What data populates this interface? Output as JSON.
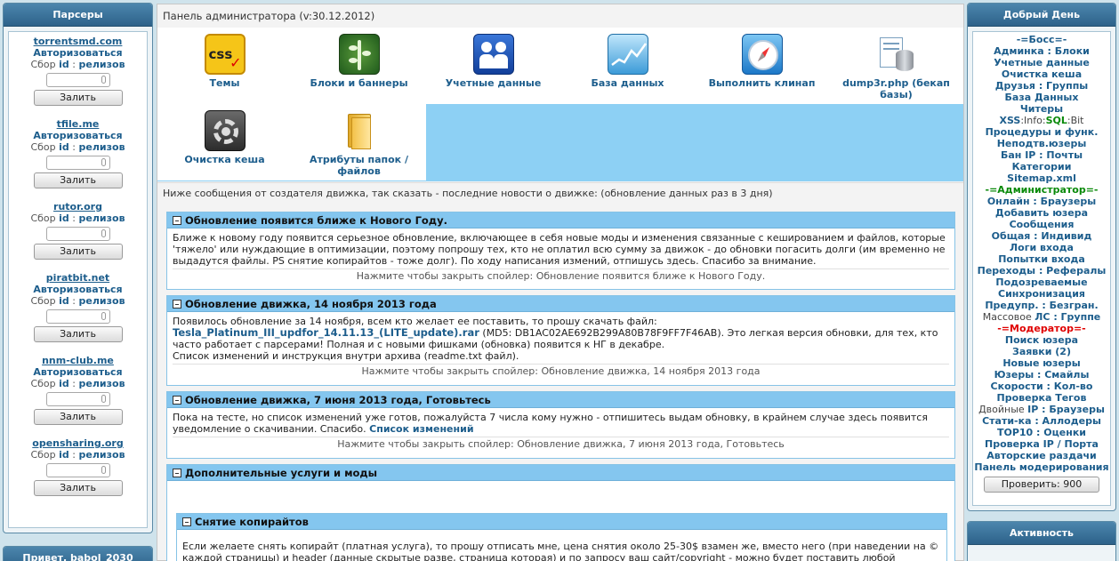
{
  "left_panel": {
    "title": "Парсеры",
    "parsers": [
      {
        "site": "torrentsmd.com",
        "auth": "Авторизоваться",
        "sbor": "Сбор",
        "id": "id",
        "sep": " : ",
        "releases": "релизов",
        "button": "Залить"
      },
      {
        "site": "tfile.me",
        "auth": "Авторизоваться",
        "sbor": "Сбор",
        "id": "id",
        "sep": " : ",
        "releases": "релизов",
        "button": "Залить"
      },
      {
        "site": "rutor.org",
        "auth": "",
        "sbor": "Сбор",
        "id": "id",
        "sep": " : ",
        "releases": "релизов",
        "button": "Залить"
      },
      {
        "site": "piratbit.net",
        "auth": "Авторизоваться",
        "sbor": "Сбор",
        "id": "id",
        "sep": " : ",
        "releases": "релизов",
        "button": "Залить"
      },
      {
        "site": "nnm-club.me",
        "auth": "Авторизоваться",
        "sbor": "Сбор",
        "id": "id",
        "sep": " : ",
        "releases": "релизов",
        "button": "Залить"
      },
      {
        "site": "opensharing.org",
        "auth": "",
        "sbor": "Сбор",
        "id": "id",
        "sep": " : ",
        "releases": "релизов",
        "button": "Залить"
      }
    ],
    "greeting": "Привет, babol_2030"
  },
  "center": {
    "title": "Панель администратора (v:30.12.2012)",
    "tiles": [
      {
        "label": "Темы",
        "icon": "css-icon"
      },
      {
        "label": "Блоки и баннеры",
        "icon": "leaf-icon"
      },
      {
        "label": "Учетные данные",
        "icon": "users-icon"
      },
      {
        "label": "База данных",
        "icon": "chart-icon"
      },
      {
        "label": "Выполнить клинап",
        "icon": "compass-icon"
      },
      {
        "label": "dump3r.php (бекап базы)",
        "icon": "database-icon"
      },
      {
        "label": "Очистка кеша",
        "icon": "gear-icon"
      },
      {
        "label": "Атрибуты папок / файлов",
        "icon": "folder-icon"
      }
    ],
    "news_note": "Ниже сообщения от создателя движка, так сказать - последние новости о движке: (обновление данных раз в 3 дня)",
    "news": [
      {
        "title": "Обновление появится ближе к Нового Году.",
        "text": "Ближе к новому году появится серьезное обновление, включающее в себя новые моды и изменения связанные с кешированием и файлов, которые 'тяжело' или нуждающие в оптимизации, поэтому попрошу тех, кто не оплатил всю сумму за движок - до обновки погасить долги (им временно не выдадутся файлы. PS снятие копирайтов - тоже долг). По ходу написания измений, отпишусь здесь. Спасибо за внимание.",
        "footer": "Нажмите чтобы закрыть спойлер: Обновление появится ближе к Нового Году."
      },
      {
        "title": "Обновление движка, 14 ноября 2013 года",
        "text_before": "Появилось обновление за 14 ноября, всем кто желает ее поставить, то прошу скачать файл:",
        "link": "Tesla_Platinum_III_updfor_14.11.13_(LITE_update).rar",
        "text_after": " (MD5: DB1AC02AE692B299A80B78F9FF7F46AB). Это легкая версия обновки, для тех, кто часто работает с парсерами! Полная и с новыми фишками (обновка) появится к НГ в декабре.",
        "text_line2": "Список изменений и инструкция внутри архива (readme.txt файл).",
        "footer": "Нажмите чтобы закрыть спойлер: Обновление движка, 14 ноября 2013 года"
      },
      {
        "title": "Обновление движка, 7 июня 2013 года, Готовьтесь",
        "text": "Пока на тесте, но список изменений уже готов, пожалуйста 7 числа кому нужно - отпишитесь выдам обновку, в крайнем случае здесь появится уведомление о скачивании. Спасибо. ",
        "link": "Список изменений",
        "footer": "Нажмите чтобы закрыть спойлер: Обновление движка, 7 июня 2013 года, Готовьтесь"
      },
      {
        "title": "Дополнительные услуги и моды",
        "inner_title": "Снятие копирайтов",
        "inner_text": "Если желаете снять копирайт (платная услуга), то прошу отписать мне, цена снятия около 25-30$ взамен же, вместо него (при наведении на © каждой страницы) и header (данные скрытые разве, страница которая) и по запросу ваш сайт/copyright - можно будет поставить любой"
      }
    ]
  },
  "right_panel": {
    "title": "Добрый День",
    "sections": {
      "boss": "-=Босс=-",
      "admin": "-=Администратор=-",
      "moder": "-=Модератор=-"
    },
    "boss_links": [
      "Админка : Блоки",
      "Учетные данные",
      "Очистка кеша",
      "Друзья : Группы",
      "База Данных",
      "Читеры"
    ],
    "xss": {
      "a": "XSS",
      "b": ":Info:",
      "c": "SQL",
      "d": ":Bit"
    },
    "boss_links2": [
      "Процедуры и функ.",
      "Неподтв.юзеры",
      "Бан IP : Почты",
      "Категории",
      "Sitemap.xml"
    ],
    "admin_links": [
      "Онлайн : Браузеры",
      "Добавить юзера",
      "Сообщения",
      "Общая : Индивид",
      "Логи входа",
      "Попытки входа",
      "Переходы : Рефералы",
      "Подозреваемые",
      "Синхронизация",
      "Предупр. : Безгран."
    ],
    "mass": {
      "a": "Массовое ",
      "b": "ЛС : Группе"
    },
    "mod_links": [
      "Поиск юзера",
      "Заявки (2)",
      "Новые юзеры",
      "Юзеры : Смайлы",
      "Скорости : Кол-во",
      "Проверка Тегов"
    ],
    "dual": {
      "a": "Двойные ",
      "b": "IP : Браузеры"
    },
    "mod_links2": [
      "Стати-ка : Аллодеры",
      "TOP10 : Оценки",
      "Проверка IP / Порта",
      "Авторские раздачи",
      "Панель модерирования"
    ],
    "check_button": "Проверить: 900",
    "activity": "Активность"
  }
}
